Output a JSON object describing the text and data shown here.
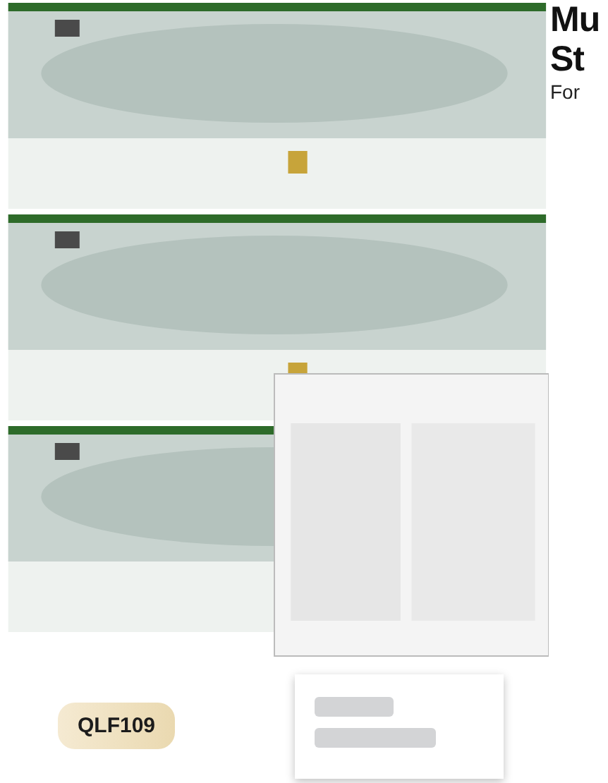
{
  "heading": {
    "line_1": "Mu",
    "line_2": "St",
    "subtitle": "For"
  },
  "badge": "QLF109"
}
